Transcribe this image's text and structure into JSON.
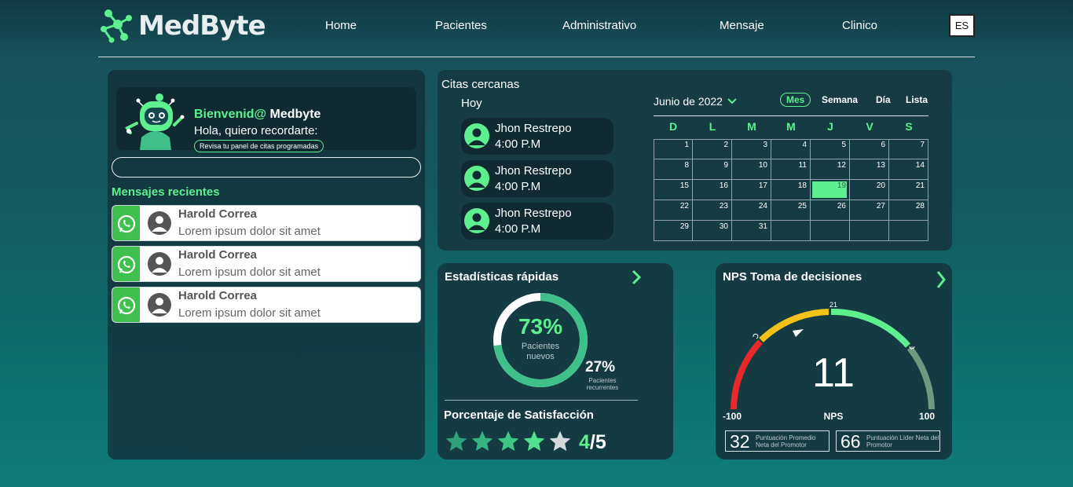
{
  "brand": {
    "name": "MedByte",
    "accent": "#5ef08f"
  },
  "nav": {
    "items": [
      "Home",
      "Pacientes",
      "Administrativo",
      "Mensaje",
      "Clinico"
    ],
    "language": "ES"
  },
  "welcome": {
    "greeting": "Bienvenid@",
    "name": "Medbyte",
    "subtitle": "Hola, quiero recordarte:",
    "pill": "Revisa tu panel de citas programadas"
  },
  "messages": {
    "title": "Mensajes recientes",
    "items": [
      {
        "name": "Harold Correa",
        "text": "Lorem ipsum dolor sit amet"
      },
      {
        "name": "Harold Correa",
        "text": "Lorem ipsum dolor sit amet"
      },
      {
        "name": "Harold Correa",
        "text": "Lorem ipsum dolor sit amet"
      }
    ]
  },
  "appointments": {
    "title": "Citas cercanas",
    "today_label": "Hoy",
    "items": [
      {
        "name": "Jhon Restrepo",
        "time": "4:00 P.M"
      },
      {
        "name": "Jhon Restrepo",
        "time": "4:00 P.M"
      },
      {
        "name": "Jhon Restrepo",
        "time": "4:00 P.M"
      }
    ]
  },
  "calendar": {
    "month": "Junio de 2022",
    "views": [
      "Mes",
      "Semana",
      "Día",
      "Lista"
    ],
    "active_view": "Mes",
    "weekdays": [
      "D",
      "L",
      "M",
      "M",
      "J",
      "V",
      "S"
    ],
    "weeks": [
      [
        "1",
        "2",
        "3",
        "4",
        "5",
        "6",
        "7"
      ],
      [
        "8",
        "9",
        "10",
        "11",
        "12",
        "13",
        "14"
      ],
      [
        "15",
        "16",
        "17",
        "18",
        "19",
        "20",
        "21"
      ],
      [
        "22",
        "23",
        "24",
        "25",
        "26",
        "27",
        "28"
      ],
      [
        "29",
        "30",
        "31",
        "",
        "",
        "",
        ""
      ]
    ],
    "highlighted_day": "19"
  },
  "stats": {
    "title": "Estadísticas rápidas",
    "new_pct": "73%",
    "new_label": "Pacientes nuevos",
    "new_fraction": 0.73,
    "recurring_pct": "27%",
    "recurring_label": "Pacientes recurrentes",
    "satisfaction_title": "Porcentaje de Satisfacción",
    "rating": 4,
    "rating_max": 5,
    "rating_num": "4",
    "rating_den": "/5"
  },
  "nps": {
    "title": "NPS Toma de decisiones",
    "value": "11",
    "label": "NPS",
    "min": "-100",
    "max": "100",
    "tick": "21",
    "promoter_avg_value": "32",
    "promoter_avg_label": "Puntuación Promedio Neta del Promotor",
    "leader_value": "66",
    "leader_label": "Puntuación Líder Neta del Promotor"
  }
}
